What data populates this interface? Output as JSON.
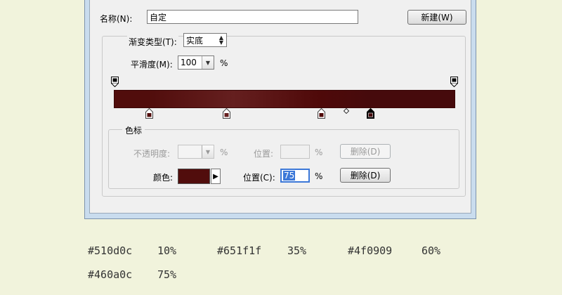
{
  "dialog": {
    "name_label": "名称(N):",
    "name_value": "自定",
    "new_button": "新建(W)",
    "gradient_type_label": "渐变类型(T):",
    "gradient_type_value": "实底",
    "smoothness_label": "平滑度(M):",
    "smoothness_value": "100",
    "smoothness_unit": "%"
  },
  "color_stops_group": {
    "title": "色标",
    "opacity_label": "不透明度:",
    "opacity_unit": "%",
    "opacity_location_label": "位置:",
    "opacity_location_unit": "%",
    "opacity_delete_button": "删除(D)",
    "color_label": "颜色:",
    "color_value": "#510d0c",
    "location_label": "位置(C):",
    "location_value": "75",
    "location_unit": "%",
    "delete_button": "删除(D)"
  },
  "gradient": {
    "colors": [
      "#510d0c",
      "#651f1f",
      "#4f0909",
      "#460a0c"
    ],
    "stop_percents": [
      10,
      35,
      60,
      75
    ]
  },
  "captions": [
    {
      "color": "#510d0c",
      "percent": "10%"
    },
    {
      "color": "#651f1f",
      "percent": "35%"
    },
    {
      "color": "#4f0909",
      "percent": "60%"
    },
    {
      "color": "#460a0c",
      "percent": "75%"
    }
  ]
}
